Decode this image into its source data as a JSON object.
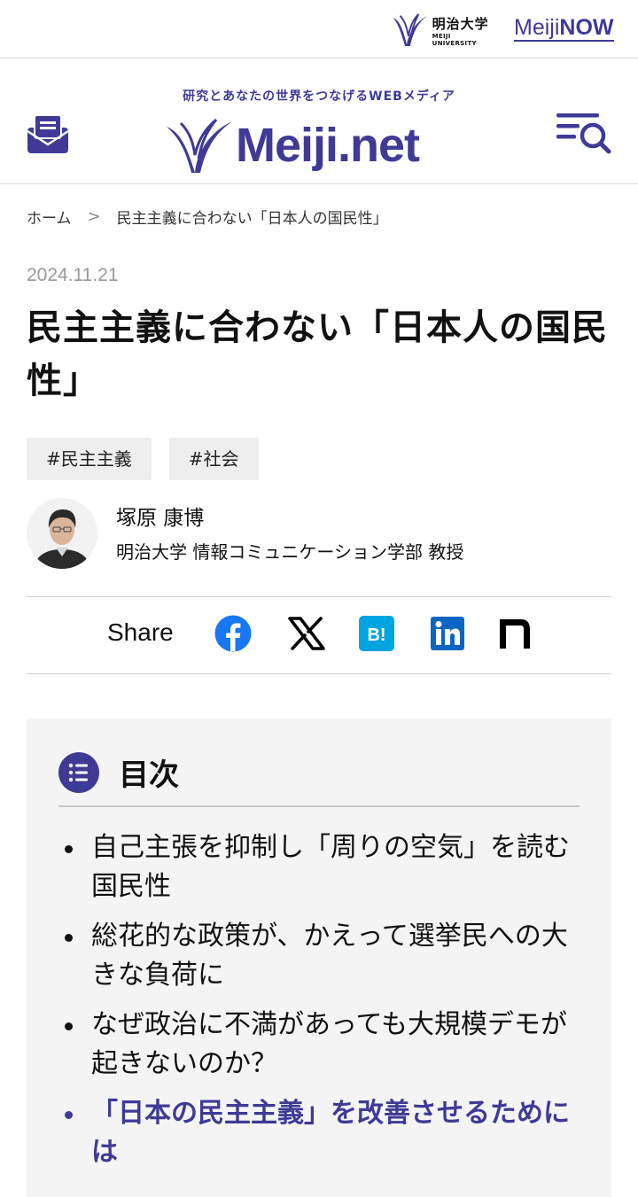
{
  "topbar": {
    "university_name_jp": "明治大学",
    "university_name_en": "MEIJI UNIVERSITY",
    "meiji_now_prefix": "Meiji",
    "meiji_now_suffix": "NOW"
  },
  "header": {
    "tagline": "研究とあなたの世界をつなげるWEBメディア",
    "site_name": "Meiji.net",
    "mail_icon": "envelope-icon",
    "menu_icon": "menu-search-icon"
  },
  "breadcrumb": {
    "home": "ホーム",
    "separator": ">",
    "current": "民主主義に合わない「日本人の国民性」"
  },
  "article": {
    "date": "2024.11.21",
    "title": "民主主義に合わない「日本人の国民性」",
    "tags": [
      "#民主主義",
      "#社会"
    ]
  },
  "author": {
    "name": "塚原 康博",
    "affiliation": "明治大学 情報コミュニケーション学部 教授"
  },
  "share": {
    "label": "Share",
    "services": [
      "facebook-icon",
      "x-icon",
      "hatena-bookmark-icon",
      "linkedin-icon",
      "note-icon"
    ]
  },
  "toc": {
    "title": "目次",
    "items": [
      "自己主張を抑制し「周りの空気」を読む国民性",
      "総花的な政策が、かえって選挙民への大きな負荷に",
      "なぜ政治に不満があっても大規模デモが起きないのか？",
      "「日本の民主主義」を改善させるためには"
    ],
    "active_index": 3
  },
  "colors": {
    "brand": "#3f3a96",
    "facebook": "#1877f2",
    "hatena": "#00a4de",
    "linkedin": "#0a66c2"
  }
}
